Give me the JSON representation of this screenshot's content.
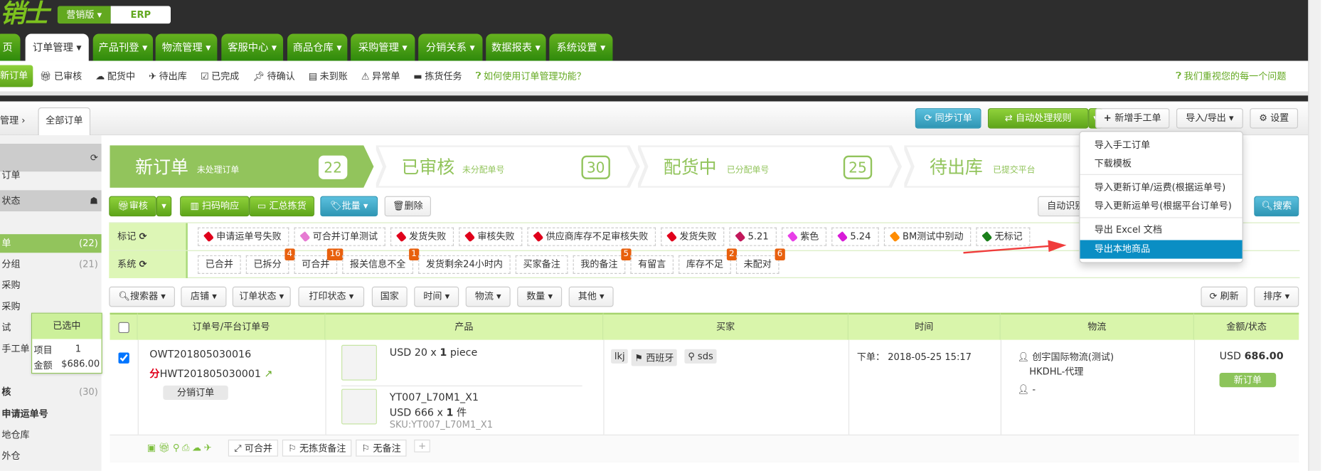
{
  "header": {
    "logo": "销士",
    "edition": "营销版",
    "erp": "ERP"
  },
  "nav": [
    "页",
    "订单管理",
    "产品刊登",
    "物流管理",
    "客服中心",
    "商品仓库",
    "采购管理",
    "分销关系",
    "数据报表",
    "系统设置"
  ],
  "subnav": {
    "items": [
      "新订单",
      "已审核",
      "配货中",
      "待出库",
      "已完成",
      "待确认",
      "未到账",
      "异常单",
      "拣货任务"
    ],
    "help": "如何使用订单管理功能？",
    "feedback": "我们重视您的每一个问题"
  },
  "breadcrumb": {
    "parent": "管理",
    "current": "全部订单"
  },
  "toolbar": {
    "sync": "同步订单",
    "auto_rules": "自动处理规则",
    "new_manual": "新增手工单",
    "import_export": "导入/导出",
    "settings": "设置"
  },
  "dropdown": {
    "items": [
      "导入手工订单",
      "下载模板",
      "导入更新订单/运费(根据运单号)",
      "导入更新运单号(根据平台订单号)",
      "导出 Excel 文档",
      "导出本地商品"
    ],
    "highlighted": "导出本地商品"
  },
  "sidebar": {
    "items": [
      {
        "label": "订单"
      },
      {
        "label": "状态"
      },
      {
        "label": "单",
        "count": "(22)"
      },
      {
        "label": "分组",
        "count": "(21)"
      },
      {
        "label": "采购"
      },
      {
        "label": "采购"
      },
      {
        "label": "试"
      },
      {
        "label": "手工单"
      },
      {
        "label": "核",
        "count": "(30)"
      },
      {
        "label": "申请运单号"
      },
      {
        "label": "地仓库"
      },
      {
        "label": "外仓"
      }
    ]
  },
  "selected_box": {
    "title": "已选中",
    "items_label": "项目",
    "items_value": "1",
    "amount_label": "金额",
    "amount_value": "$686.00"
  },
  "stages": [
    {
      "title": "新订单",
      "sub": "未处理订单",
      "count": "22"
    },
    {
      "title": "已审核",
      "sub": "未分配单号",
      "count": "30"
    },
    {
      "title": "配货中",
      "sub": "已分配单号",
      "count": "25"
    },
    {
      "title": "待出库",
      "sub": "已提交平台"
    }
  ],
  "actions": {
    "approve": "审核",
    "scan": "扫码响应",
    "summary": "汇总拣货",
    "batch": "批量",
    "delete": "删除",
    "auto_detect": "自动识别",
    "search": "搜索"
  },
  "mark_row": {
    "label": "标记",
    "tags": [
      {
        "t": "申请运单号失败",
        "c": "#e0001b"
      },
      {
        "t": "可合并订单测试",
        "c": "#e67ad2"
      },
      {
        "t": "发货失败",
        "c": "#e0001b"
      },
      {
        "t": "审核失败",
        "c": "#e0001b"
      },
      {
        "t": "供应商库存不足审核失败",
        "c": "#e0001b"
      },
      {
        "t": "发货失败",
        "c": "#e0001b"
      },
      {
        "t": "5.21",
        "c": "#c2185b"
      },
      {
        "t": "紫色",
        "c": "#e83fe8"
      },
      {
        "t": "5.24",
        "c": "#d81bd8"
      },
      {
        "t": "BM测试中别动",
        "c": "#ff8c00"
      },
      {
        "t": "无标记",
        "c": "#1a7f1a"
      }
    ]
  },
  "system_row": {
    "label": "系统",
    "tags": [
      {
        "t": "已合并"
      },
      {
        "t": "已拆分",
        "b": "4"
      },
      {
        "t": "可合并",
        "b": "16"
      },
      {
        "t": "报关信息不全",
        "b": "1"
      },
      {
        "t": "发货剩余24小时内"
      },
      {
        "t": "买家备注"
      },
      {
        "t": "我的备注",
        "b": "5"
      },
      {
        "t": "有留言"
      },
      {
        "t": "库存不足",
        "b": "2"
      },
      {
        "t": "未配对",
        "b": "6"
      }
    ]
  },
  "filters": [
    "搜索器",
    "店铺",
    "订单状态",
    "打印状态",
    "国家",
    "时间",
    "物流",
    "数量",
    "其他"
  ],
  "refresh": "刷新",
  "sort": "排序",
  "table": {
    "headers": [
      "订单号/平台订单号",
      "产品",
      "买家",
      "时间",
      "物流",
      "金额/状态"
    ],
    "row": {
      "order_no": "OWT201805030016",
      "fen": "分",
      "platform_no": "HWT201805030001",
      "dist_tag": "分销订单",
      "p1_price": "USD 20 x ",
      "p1_qty": "1",
      "p1_unit": " piece",
      "p2_sku": "YT007_L70M1_X1",
      "p2_price": "USD 666 x ",
      "p2_qty": "1",
      "p2_unit": " 件",
      "p2_skuline": "SKU:YT007_L70M1_X1",
      "buyer": "lkj",
      "country": "西班牙",
      "location": "sds",
      "time_label": "下单：",
      "time": "2018-05-25 15:17",
      "logistics": "创宇国际物流(测试)",
      "logistics2": "HKDHL-代理",
      "logistics3": "-",
      "currency": "USD",
      "amount": "686.00",
      "status": "新订单",
      "footer_merge": "可合并",
      "footer_pick": "无拣货备注",
      "footer_note": "无备注"
    }
  }
}
